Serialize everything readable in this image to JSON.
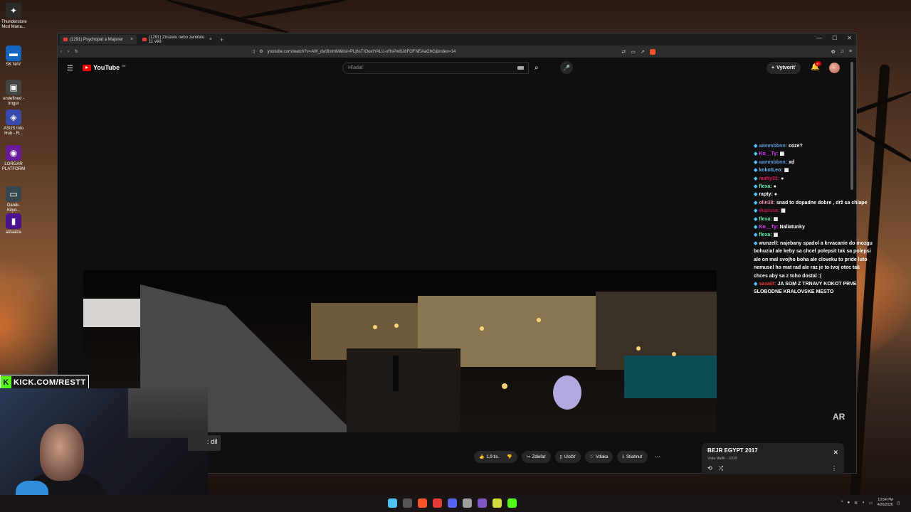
{
  "desktop": {
    "icons": [
      {
        "label": "Thunderstore Mod Mana...",
        "color": "#2a2a2a",
        "glyph": "✦",
        "icon": "thunderstore-icon"
      },
      {
        "label": "SK NAY",
        "color": "#1565c0",
        "glyph": "▬",
        "icon": "nay-icon"
      },
      {
        "label": "undefined - Imgur",
        "color": "#444444",
        "glyph": "▣",
        "icon": "imgur-icon"
      },
      {
        "label": "ASUS Info Hub - R...",
        "color": "#3949ab",
        "glyph": "◈",
        "icon": "asus-icon"
      },
      {
        "label": "LORGAR PLATFORM",
        "color": "#6a1b9a",
        "glyph": "◉",
        "icon": "lorgar-icon"
      },
      {
        "label": "Darek-Kilyd...",
        "color": "#37474f",
        "glyph": "▭",
        "icon": "file-icon"
      },
      {
        "label": "alzaalza",
        "color": "#4a148c",
        "glyph": "▮",
        "icon": "alza-icon"
      }
    ]
  },
  "browser": {
    "tabs": [
      {
        "title": "(1291) Psychopat a Majsner",
        "active": true
      },
      {
        "title": "(1291) Zmizelo nebo zemřelo 11 věd",
        "active": false
      }
    ],
    "new_tab": "+",
    "url": "youtube.com/watch?v=AW_dw3txlmM&list=PLj6sTIOuetYALU-xRsPwBJ8FOFNEAaGhG&index=14"
  },
  "youtube": {
    "logo": "YouTube",
    "country": "SK",
    "search_placeholder": "Hľadať",
    "create_label": "Vytvoriť",
    "notif_badge": "9+",
    "caption_fragment": ": díl",
    "actions": {
      "like": "1,9 tis.",
      "share": "Zdieľať",
      "save": "Uložiť",
      "thanks": "Vďaka",
      "download": "Stiahnuť"
    },
    "playlist": {
      "title": "BEJR EGYPT 2017",
      "subtitle": "Vojta Mafík - 12/29"
    },
    "watermark": "AR"
  },
  "chat": [
    {
      "user": "aammbbnn:",
      "msg": "coze?",
      "color": "#5b9bd5"
    },
    {
      "user": "Ko__Ty:",
      "msg": "▩",
      "color": "#e040fb"
    },
    {
      "user": "aammbbnn:",
      "msg": "xd",
      "color": "#5b9bd5"
    },
    {
      "user": "kokotLeo:",
      "msg": "▩",
      "color": "#64b5f6"
    },
    {
      "user": "matty31:",
      "msg": "●",
      "color": "#d81b60"
    },
    {
      "user": "flexa:",
      "msg": "●",
      "color": "#69f0ae"
    },
    {
      "user": "rapty:",
      "msg": "●",
      "color": "#ffffff"
    },
    {
      "user": "olin38:",
      "msg": "snad to dopadne dobre , drž sa chlape",
      "color": "#f48fb1"
    },
    {
      "user": "dupissa:",
      "msg": "▩",
      "color": "#c2185b"
    },
    {
      "user": "flexa:",
      "msg": "▩",
      "color": "#69f0ae"
    },
    {
      "user": "Ko__Ty:",
      "msg": "Naliatunky",
      "color": "#e040fb"
    },
    {
      "user": "flexa:",
      "msg": "▩",
      "color": "#69f0ae"
    },
    {
      "user": "wunzell:",
      "msg": "najebany spadol a krvacanie do mozgu bohuzial ale keby sa chcel polepsit tak sa polepsi ale on mal svojho boha ale cloveku to pride luto nemusel ho mat rad ale raz je to tvoj otec tak chces aby sa z toho dostal :(",
      "color": "#ffffff"
    },
    {
      "user": "sasaiit:",
      "msg": "JA SOM Z TRNAVY KOKOT PRVE SLOBODNE KRALOVSKE MESTO",
      "color": "#e53935"
    }
  ],
  "stream": {
    "kick_url": "KICK.COM/RESTT"
  },
  "taskbar": {
    "apps": [
      {
        "name": "start",
        "color": "#4fc3f7"
      },
      {
        "name": "task-view",
        "color": "#555555"
      },
      {
        "name": "brave",
        "color": "#fb542b"
      },
      {
        "name": "maps",
        "color": "#e53935"
      },
      {
        "name": "discord",
        "color": "#5865f2"
      },
      {
        "name": "chrome",
        "color": "#9e9e9e"
      },
      {
        "name": "obs",
        "color": "#7e57c2"
      },
      {
        "name": "app",
        "color": "#cddc39"
      },
      {
        "name": "kick",
        "color": "#53fc18"
      }
    ],
    "time": "10:54 PM",
    "date": "4/26/2026"
  }
}
